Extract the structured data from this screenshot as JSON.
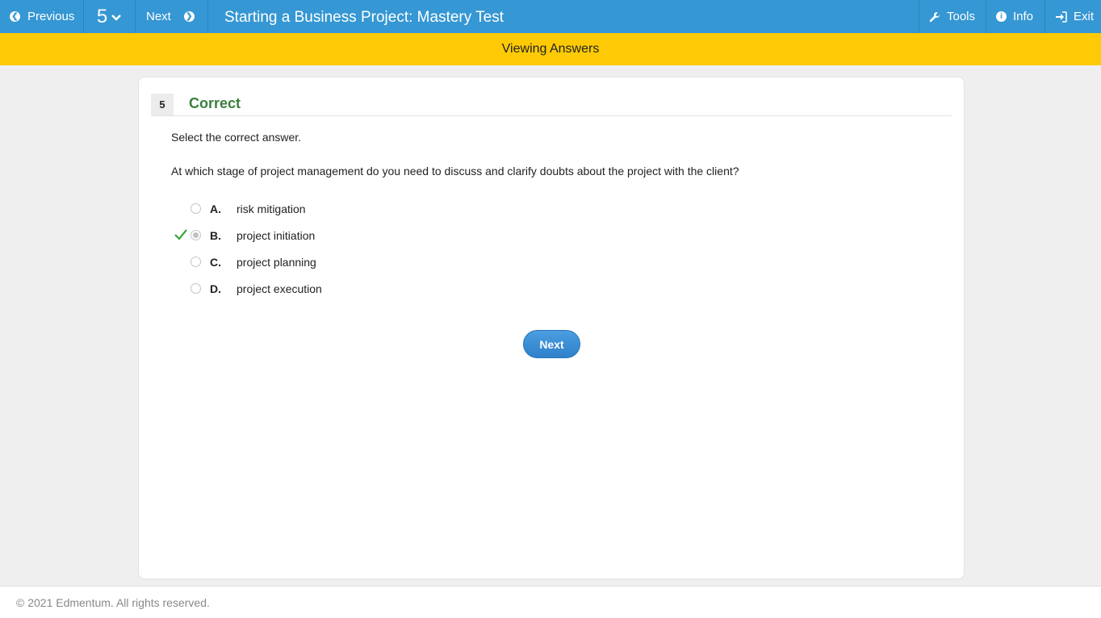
{
  "topbar": {
    "previous_label": "Previous",
    "question_number": "5",
    "next_label": "Next",
    "title": "Starting a Business Project: Mastery Test",
    "tools_label": "Tools",
    "info_label": "Info",
    "exit_label": "Exit"
  },
  "banner": {
    "text": "Viewing Answers"
  },
  "question": {
    "number": "5",
    "status": "Correct",
    "instruction": "Select the correct answer.",
    "prompt": "At which stage of project management do you need to discuss and clarify doubts about the project with the client?",
    "options": [
      {
        "letter": "A.",
        "text": "risk mitigation",
        "selected": false,
        "correct": false
      },
      {
        "letter": "B.",
        "text": "project initiation",
        "selected": true,
        "correct": true
      },
      {
        "letter": "C.",
        "text": "project planning",
        "selected": false,
        "correct": false
      },
      {
        "letter": "D.",
        "text": "project execution",
        "selected": false,
        "correct": false
      }
    ],
    "next_button": "Next"
  },
  "footer": {
    "copyright": "© 2021 Edmentum. All rights reserved."
  },
  "colors": {
    "topbar": "#3597d3",
    "banner": "#fdca05",
    "correct_status": "#3a7f3e",
    "check": "#3aa63a",
    "next_button": "#3a8fd6"
  }
}
